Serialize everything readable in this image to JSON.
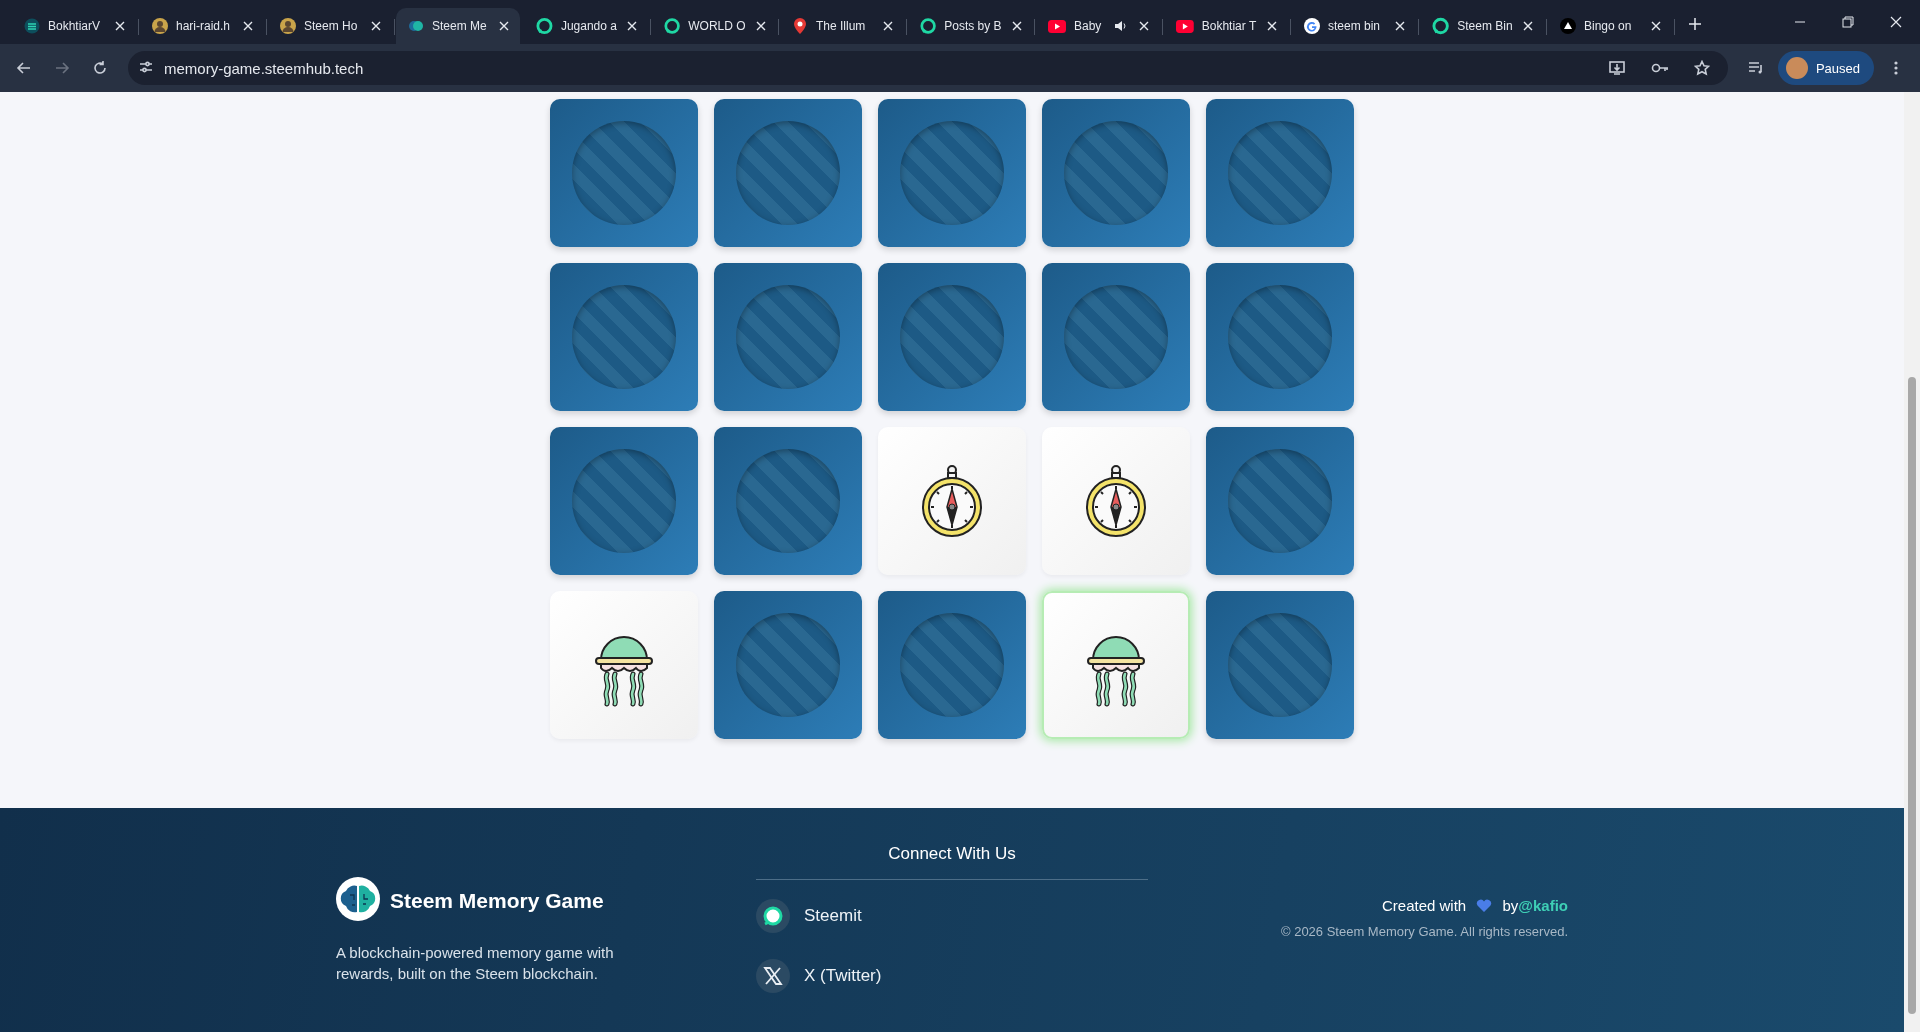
{
  "browser": {
    "tabs": [
      {
        "title": "BokhtiarV",
        "selected": false,
        "audio": false
      },
      {
        "title": "hari-raid.h",
        "selected": false,
        "audio": false
      },
      {
        "title": "Steem Ho",
        "selected": false,
        "audio": false
      },
      {
        "title": "Steem Me",
        "selected": true,
        "audio": false
      },
      {
        "title": "Jugando a",
        "selected": false,
        "audio": false
      },
      {
        "title": "WORLD O",
        "selected": false,
        "audio": false
      },
      {
        "title": "The Illum",
        "selected": false,
        "audio": false
      },
      {
        "title": "Posts by B",
        "selected": false,
        "audio": false
      },
      {
        "title": "Baby",
        "selected": false,
        "audio": true
      },
      {
        "title": "Bokhtiar T",
        "selected": false,
        "audio": false
      },
      {
        "title": "steem bin",
        "selected": false,
        "audio": false
      },
      {
        "title": "Steem Bin",
        "selected": false,
        "audio": false
      },
      {
        "title": "Bingo on",
        "selected": false,
        "audio": false
      }
    ],
    "url": "memory-game.steemhub.tech",
    "profile": "Paused"
  },
  "board": {
    "cards": [
      {
        "kind": "hidden",
        "highlighted": false
      },
      {
        "kind": "hidden",
        "highlighted": false
      },
      {
        "kind": "hidden",
        "highlighted": false
      },
      {
        "kind": "hidden",
        "highlighted": false
      },
      {
        "kind": "hidden",
        "highlighted": false
      },
      {
        "kind": "hidden",
        "highlighted": false
      },
      {
        "kind": "hidden",
        "highlighted": false
      },
      {
        "kind": "hidden",
        "highlighted": false
      },
      {
        "kind": "hidden",
        "highlighted": false
      },
      {
        "kind": "hidden",
        "highlighted": false
      },
      {
        "kind": "hidden",
        "highlighted": false
      },
      {
        "kind": "hidden",
        "highlighted": false
      },
      {
        "kind": "compass",
        "highlighted": false
      },
      {
        "kind": "compass",
        "highlighted": false
      },
      {
        "kind": "hidden",
        "highlighted": false
      },
      {
        "kind": "jellyfish",
        "highlighted": false
      },
      {
        "kind": "hidden",
        "highlighted": false
      },
      {
        "kind": "hidden",
        "highlighted": false
      },
      {
        "kind": "jellyfish",
        "highlighted": true
      },
      {
        "kind": "hidden",
        "highlighted": false
      }
    ]
  },
  "footer": {
    "brand": "Steem Memory Game",
    "description": "A blockchain-powered memory game with rewards, built on the Steem blockchain.",
    "connect_title": "Connect With Us",
    "links": [
      {
        "label": "Steemit"
      },
      {
        "label": "X (Twitter)"
      }
    ],
    "credit_prefix": "Created with",
    "credit_by": "by",
    "credit_handle": "@kafio",
    "copyright": "© 2026 Steem Memory Game. All rights reserved."
  }
}
